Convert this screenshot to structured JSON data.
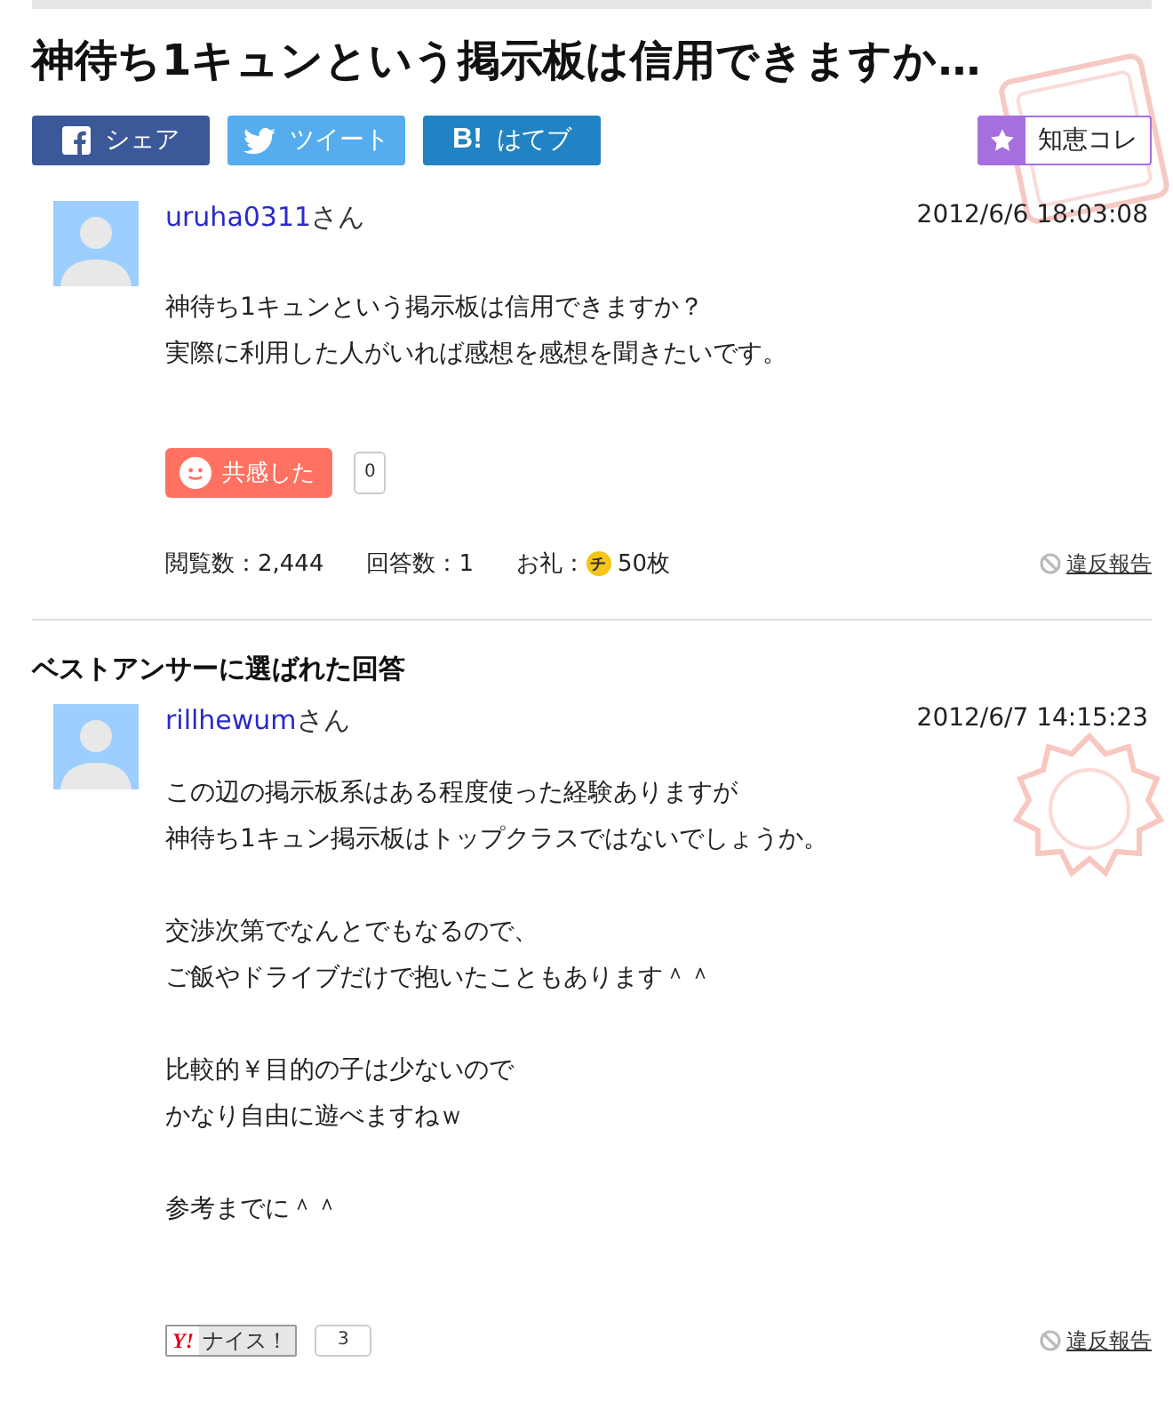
{
  "title": "神待ち1キュンという掲示板は信用できますか…",
  "share_buttons": [
    {
      "kind": "facebook",
      "label": "シェア"
    },
    {
      "kind": "twitter",
      "label": "ツイート"
    },
    {
      "kind": "hatena",
      "icon_text": "B!",
      "label": "はてブ"
    }
  ],
  "collection_button": {
    "label": "知恵コレ"
  },
  "question": {
    "user": "uruha0311",
    "honorific": "さん",
    "date": "2012/6/6  18:03:08",
    "body": [
      [
        "神待ち1キュンという掲示板は信用できますか？",
        "実際に利用した人がいれば感想を感想を聞きたいです。"
      ]
    ],
    "empathy": {
      "label": "共感した",
      "count": "0"
    },
    "stats": [
      {
        "label": "閲覧数：",
        "value": "2,444"
      },
      {
        "label": "回答数：",
        "value": "1"
      },
      {
        "label": "お礼：",
        "value": "50枚",
        "coin": "チ"
      }
    ],
    "report": "違反報告"
  },
  "best_answer": {
    "heading": "ベストアンサーに選ばれた回答",
    "user": "rillhewum",
    "honorific": "さん",
    "date": "2012/6/7  14:15:23",
    "body": [
      [
        "この辺の掲示板系はある程度使った経験ありますが",
        "神待ち1キュン掲示板はトップクラスではないでしょうか。"
      ],
      [
        "交渉次第でなんとでもなるので、",
        "ご飯やドライブだけで抱いたこともあります＾＾"
      ],
      [
        "比較的￥目的の子は少ないので",
        "かなり自由に遊べますねｗ"
      ],
      [
        "参考までに＾＾"
      ]
    ],
    "nice": {
      "logo": "Y!",
      "label": "ナイス！",
      "count": "3"
    },
    "report": "違反報告"
  }
}
